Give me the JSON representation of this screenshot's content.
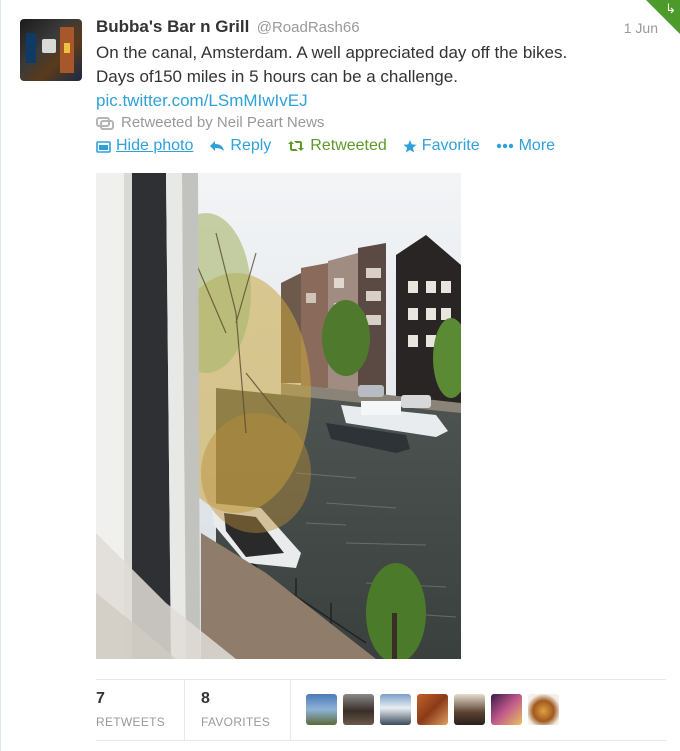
{
  "tweet": {
    "fullname": "Bubba's Bar n Grill",
    "username": "@RoadRash66",
    "time": "1 Jun",
    "text_line1": "On the canal, Amsterdam.  A well appreciated day off the bikes.",
    "text_line2": "Days of150 miles in 5 hours can be a challenge.",
    "link": "pic.twitter.com/LSmMIwIvEJ",
    "context": "Retweeted by Neil Peart News"
  },
  "actions": {
    "hide_photo": "Hide photo",
    "reply": "Reply",
    "retweeted": "Retweeted",
    "favorite": "Favorite",
    "more": "More"
  },
  "stats": {
    "retweets_count": "7",
    "retweets_label": "RETWEETS",
    "favorites_count": "8",
    "favorites_label": "FAVORITES"
  },
  "colors": {
    "link": "#2fa1d9",
    "retweeted_green": "#5c9a2a",
    "muted": "#999999"
  },
  "icons": [
    "retweet-icon",
    "photo-icon",
    "reply-icon",
    "star-icon",
    "ellipsis-icon",
    "corner-retweet-icon"
  ]
}
